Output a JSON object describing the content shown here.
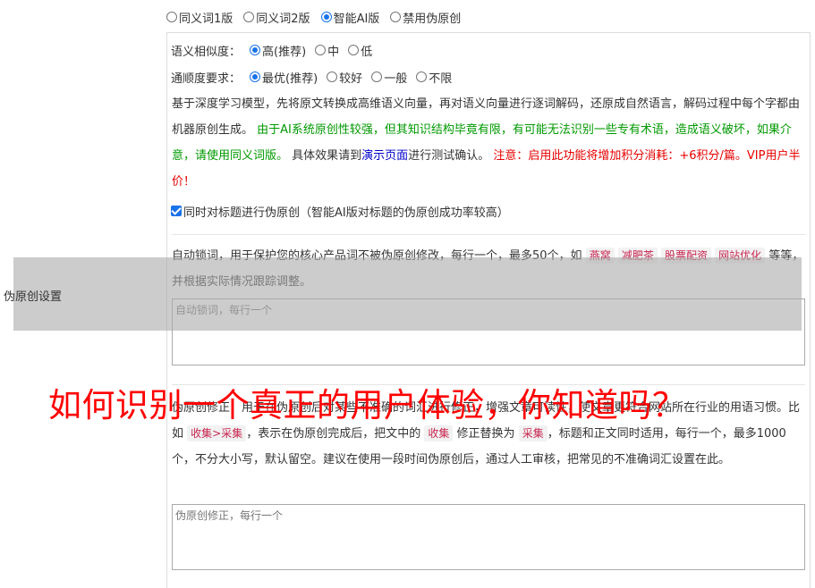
{
  "modes": [
    {
      "label": "同义词1版",
      "checked": false
    },
    {
      "label": "同义词2版",
      "checked": false
    },
    {
      "label": "智能AI版",
      "checked": true
    },
    {
      "label": "禁用伪原创",
      "checked": false
    }
  ],
  "similarity": {
    "label": "语义相似度：",
    "options": [
      {
        "label": "高(推荐)",
        "checked": true
      },
      {
        "label": "中",
        "checked": false
      },
      {
        "label": "低",
        "checked": false
      }
    ]
  },
  "fluency": {
    "label": "通顺度要求：",
    "options": [
      {
        "label": "最优(推荐)",
        "checked": true
      },
      {
        "label": "较好",
        "checked": false
      },
      {
        "label": "一般",
        "checked": false
      },
      {
        "label": "不限",
        "checked": false
      }
    ]
  },
  "description": {
    "part1": "基于深度学习模型，先将原文转换成高维语义向量，再对语义向量进行逐词解码，还原成自然语言，解码过程中每个字都由机器原创生成。",
    "part2_green": "由于AI系统原创性较强，但其知识结构毕竟有限，有可能无法识别一些专有术语，造成语义破坏，如果介意，请使用同义词版。",
    "part3": "具体效果请到",
    "link_text": "演示页面",
    "part4": "进行测试确认。",
    "part5_red": "注意：启用此功能将增加积分消耗：+6积分/篇。VIP用户半价！"
  },
  "title_checkbox": {
    "label": "同时对标题进行伪原创（智能AI版对标题的伪原创成功率较高）",
    "checked": true
  },
  "lock_words": {
    "text1": "自动锁词，用于保护您的核心产品词不被伪原创修改，每行一个，最多50个，如",
    "tags": [
      "燕窝",
      "减肥茶",
      "股票配资",
      "网站优化"
    ],
    "text2": "等等，并根据实际情况跟踪调整。",
    "placeholder": "自动锁词，每行一个"
  },
  "side_label": "伪原创设置",
  "correction": {
    "text1": "伪原创修正，用于在伪原创后对某些不准确的词汇进行修正，增强文章可读性，使文章更符合网站所在行业的用语习惯。比如",
    "tag1": "收集>采集",
    "text2": "，表示在伪原创完成后，把文中的",
    "tag2": "收集",
    "text3": "修正替换为",
    "tag3": "采集",
    "text4": "，标题和正文同时适用，每行一个，最多1000个，不分大小写，默认留空。建议在使用一段时间伪原创后，通过人工审核，把常见的不准确词汇设置在此。",
    "placeholder": "伪原创修正，每行一个"
  },
  "overlay_headline": "如何识别一个真正的用户体验，你知道吗？",
  "colors": {
    "accent": "#1a73e8",
    "green": "#009900",
    "red": "#e60000",
    "link": "#0000cc",
    "overlay": "#ff0000"
  }
}
